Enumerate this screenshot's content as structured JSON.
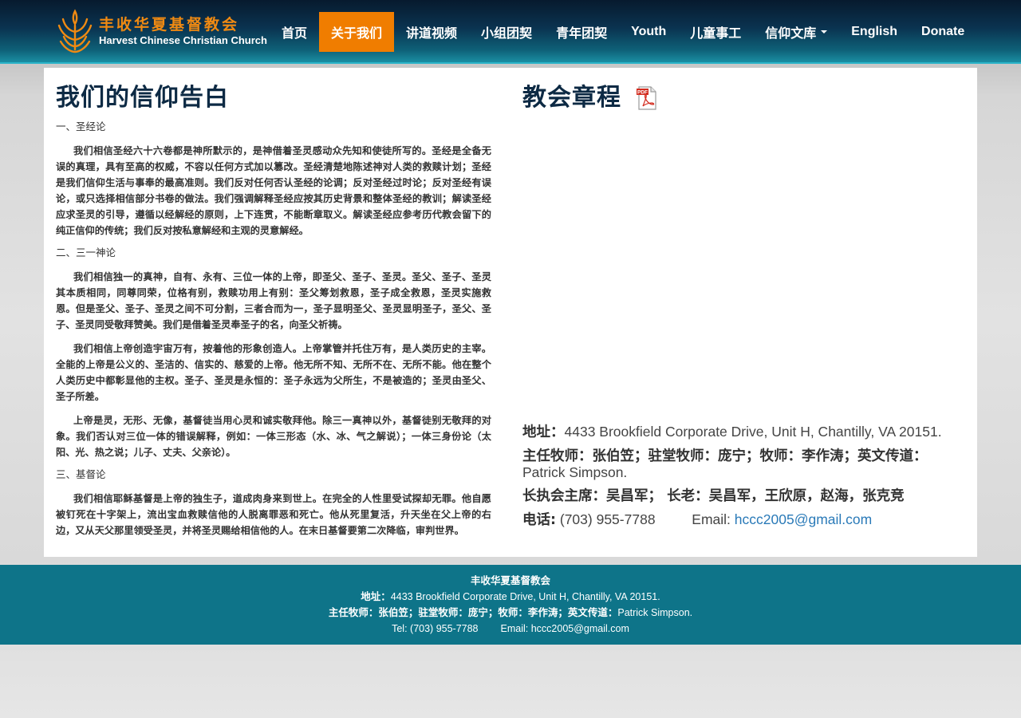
{
  "brand": {
    "name_zh": "丰收华夏基督教会",
    "name_en": "Harvest Chinese Christian Church",
    "accent_color": "#f07d00",
    "header_color": "#0a3350",
    "footer_color": "#0e7489",
    "logo_icon": "wheat-logo-icon"
  },
  "nav": {
    "items": [
      {
        "label": "首页",
        "active": false
      },
      {
        "label": "关于我们",
        "active": true
      },
      {
        "label": "讲道视频",
        "active": false
      },
      {
        "label": "小组团契",
        "active": false
      },
      {
        "label": "青年团契",
        "active": false
      },
      {
        "label": "Youth",
        "active": false
      },
      {
        "label": "儿童事工",
        "active": false
      },
      {
        "label": "信仰文库",
        "active": false,
        "dropdown": true
      },
      {
        "label": "English",
        "active": false
      },
      {
        "label": "Donate",
        "active": false
      }
    ]
  },
  "faith": {
    "title": "我们的信仰告白",
    "sections": [
      {
        "heading": "一、圣经论",
        "paragraphs": [
          "我们相信圣经六十六卷都是神所默示的，是神借着圣灵感动众先知和使徒所写的。圣经是全备无误的真理，具有至高的权威，不容以任何方式加以篡改。圣经清楚地陈述神对人类的救赎计划；圣经是我们信仰生活与事奉的最高准则。我们反对任何否认圣经的论调；反对圣经过时论；反对圣经有误论，或只选择相信部分书卷的做法。我们强调解释圣经应按其历史背景和整体圣经的教训；解读圣经应求圣灵的引导，遵循以经解经的原则，上下连贯，不能断章取义。解读圣经应参考历代教会留下的纯正信仰的传统；我们反对按私意解经和主观的灵意解经。"
        ]
      },
      {
        "heading": "二、三一神论",
        "paragraphs": [
          "我们相信独一的真神，自有、永有、三位一体的上帝，即圣父、圣子、圣灵。圣父、圣子、圣灵其本质相同，同尊同荣，位格有别，救赎功用上有别：圣父筹划救恩，圣子成全救恩，圣灵实施救恩。但是圣父、圣子、圣灵之间不可分割，三者合而为一，圣子显明圣父、圣灵显明圣子，圣父、圣子、圣灵同受敬拜赞美。我们是借着圣灵奉圣子的名，向圣父祈祷。",
          "我们相信上帝创造宇宙万有，按着他的形象创造人。上帝掌管并托住万有，是人类历史的主宰。全能的上帝是公义的、圣洁的、信实的、慈爱的上帝。他无所不知、无所不在、无所不能。他在整个人类历史中都彰显他的主权。圣子、圣灵是永恒的：圣子永远为父所生，不是被造的；圣灵由圣父、圣子所差。",
          "上帝是灵，无形、无像，基督徒当用心灵和诚实敬拜他。除三一真神以外，基督徒别无敬拜的对象。我们否认对三位一体的错误解释，例如：一体三形态（水、冰、气之解说）；一体三身份论（太阳、光、热之说；儿子、丈夫、父亲论）。"
        ]
      },
      {
        "heading": "三、基督论",
        "paragraphs": [
          "我们相信耶稣基督是上帝的独生子，道成肉身来到世上。在完全的人性里受试探却无罪。他自愿被钉死在十字架上，流出宝血救赎信他的人脱离罪恶和死亡。他从死里复活，升天坐在父上帝的右边，又从天父那里领受圣灵，并将圣灵赐给相信他的人。在末日基督要第二次降临，审判世界。"
        ]
      }
    ]
  },
  "charter": {
    "title": "教会章程",
    "pdf_icon": "pdf-file-icon",
    "pdf_badge": "PDF"
  },
  "contact": {
    "address_label": "地址：",
    "address": "4433 Brookfield Corporate Drive, Unit H, Chantilly, VA 20151.",
    "pastors_label": "主任牧师：张伯笠；驻堂牧师：庞宁；牧师：李作涛；英文传道：",
    "pastors_value": "Patrick Simpson.",
    "board_label": "长执会主席：吴昌军；  长老：吴昌军，王欣原，赵海，张克竞",
    "phone_label": "电话:",
    "phone": "(703) 955-7788",
    "email_label": "Email:",
    "email": "hccc2005@gmail.com"
  },
  "footer": {
    "name": "丰收华夏基督教会",
    "address_label": "地址：",
    "address": "4433 Brookfield Corporate Drive, Unit H, Chantilly, VA 20151.",
    "pastors": "主任牧师：张伯笠；驻堂牧师：庞宁；牧师：李作涛；英文传道：",
    "pastors_en": "Patrick Simpson.",
    "tel": "Tel: (703) 955-7788",
    "email": "Email: hccc2005@gmail.com"
  }
}
